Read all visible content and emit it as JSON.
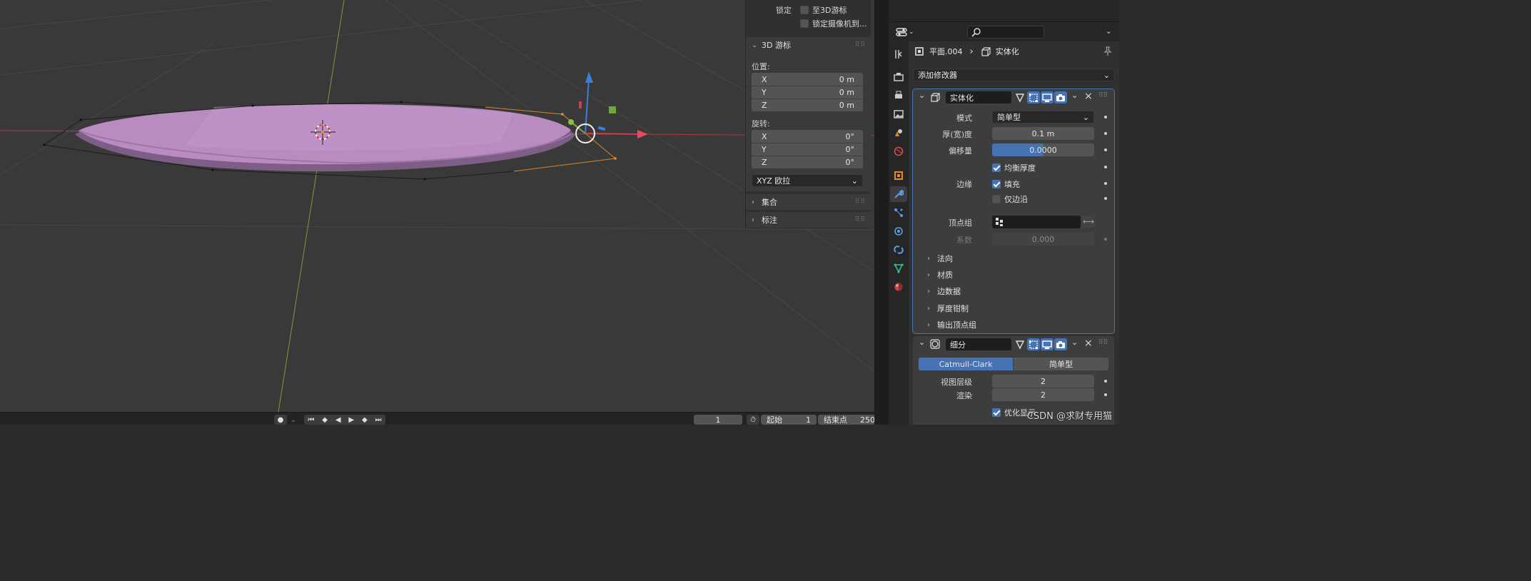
{
  "npanel": {
    "lock_label": "锁定",
    "lock_to_cursor": "至3D游标",
    "lock_camera": "锁定摄像机到...",
    "cursor_section": "3D 游标",
    "location_label": "位置:",
    "location": [
      {
        "axis": "X",
        "value": "0 m"
      },
      {
        "axis": "Y",
        "value": "0 m"
      },
      {
        "axis": "Z",
        "value": "0 m"
      }
    ],
    "rotation_label": "旋转:",
    "rotation": [
      {
        "axis": "X",
        "value": "0°"
      },
      {
        "axis": "Y",
        "value": "0°"
      },
      {
        "axis": "Z",
        "value": "0°"
      }
    ],
    "rotation_mode": "XYZ 欧拉",
    "collections_section": "集合",
    "annotations_section": "标注"
  },
  "timeline": {
    "current_frame": "1",
    "start_label": "起始",
    "start_value": "1",
    "end_label": "结束点",
    "end_value": "250"
  },
  "props": {
    "object_name": "平面.004",
    "modifier_breadcrumb": "实体化",
    "add_modifier": "添加修改器",
    "solidify": {
      "name": "实体化",
      "mode_label": "模式",
      "mode_value": "简单型",
      "thickness_label": "厚(宽)度",
      "thickness_value": "0.1 m",
      "offset_label": "偏移量",
      "offset_value": "0.0000",
      "even_thickness": "均衡厚度",
      "rim_label": "边缘",
      "fill_label": "填充",
      "only_rim": "仅边沿",
      "vertex_group_label": "顶点组",
      "factor_label": "系数",
      "factor_value": "0.000",
      "subpanels": [
        "法向",
        "材质",
        "边数据",
        "厚度钳制",
        "输出顶点组"
      ]
    },
    "subdivision": {
      "name": "细分",
      "type_catmull": "Catmull-Clark",
      "type_simple": "简单型",
      "viewport_levels_label": "视图层级",
      "viewport_levels_value": "2",
      "render_label": "渲染",
      "render_value": "2",
      "optimal_display": "优化显示"
    }
  },
  "watermark": "CSDN @求财专用猫",
  "colors": {
    "accent": "#4772b3",
    "mesh": "#b98bc0",
    "x_axis": "#c9404f",
    "y_axis": "#7fa33a",
    "z_axis": "#3a7fd8"
  }
}
